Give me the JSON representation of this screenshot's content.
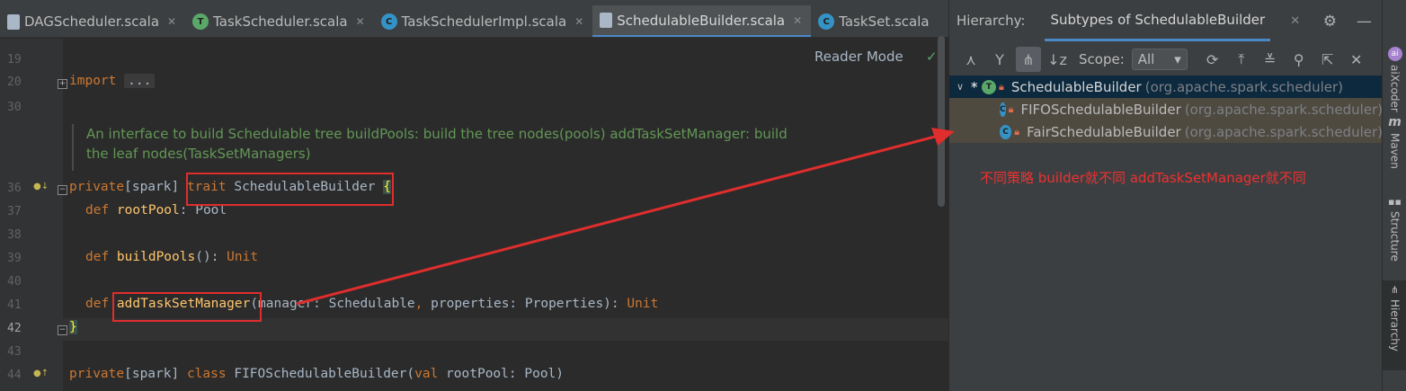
{
  "editor": {
    "tabs": [
      {
        "label": "DAGScheduler.scala",
        "kind": "file",
        "active": false
      },
      {
        "label": "TaskScheduler.scala",
        "kind": "trait",
        "active": false
      },
      {
        "label": "TaskSchedulerImpl.scala",
        "kind": "class",
        "active": false
      },
      {
        "label": "SchedulableBuilder.scala",
        "kind": "file",
        "active": true
      },
      {
        "label": "TaskSet.scala",
        "kind": "class",
        "active": false
      }
    ],
    "reader_mode": "Reader Mode",
    "line_numbers": [
      "19",
      "20",
      "30",
      "36",
      "37",
      "38",
      "39",
      "40",
      "41",
      "42",
      "43",
      "44"
    ],
    "code": {
      "import_kw": "import",
      "import_folded": "...",
      "doc_line1": "An interface to build Schedulable tree buildPools: build the tree nodes(pools) addTaskSetManager: build",
      "doc_line2": "the leaf nodes(TaskSetManagers)",
      "l36_mod": "private",
      "l36_scope": "[spark] ",
      "l36_kw": "trait",
      "l36_name": " SchedulableBuilder ",
      "l36_brace": "{",
      "l37_kw": "def ",
      "l37_fn": "rootPool",
      "l37_rest": ": Pool",
      "l39_kw": "def ",
      "l39_fn": "buildPools",
      "l39_rest": "(): ",
      "l39_type": "Unit",
      "l41_kw": "def ",
      "l41_fn": "addTaskSetManager",
      "l41_rest": "(manager: Schedulable",
      "l41_comma": ", ",
      "l41_rest2": "properties: Properties): ",
      "l41_type": "Unit",
      "l42_brace": "}",
      "l44_mod": "private",
      "l44_scope": "[spark] ",
      "l44_kw": "class",
      "l44_rest": " FIFOSchedulableBuilder(",
      "l44_val": "val",
      "l44_rest2": " rootPool: Pool)"
    }
  },
  "hierarchy": {
    "title": "Hierarchy:",
    "tab": "Subtypes of SchedulableBuilder",
    "scope_label": "Scope:",
    "scope_value": "All",
    "nodes": [
      {
        "name": "SchedulableBuilder",
        "package": "(org.apache.spark.scheduler)",
        "icon": "trait-icon",
        "root": true
      },
      {
        "name": "FIFOSchedulableBuilder",
        "package": "(org.apache.spark.scheduler)",
        "icon": "class-icon",
        "root": false
      },
      {
        "name": "FairSchedulableBuilder",
        "package": "(org.apache.spark.scheduler)",
        "icon": "class-icon",
        "root": false
      }
    ],
    "annotation": "不同策略 builder就不同 addTaskSetManager就不同"
  },
  "side_strip": {
    "items": [
      "aiXcoder",
      "Maven",
      "Structure",
      "Hierarchy"
    ]
  },
  "colors": {
    "accent": "#4a88c7",
    "annotation_red": "#e02d2d"
  }
}
